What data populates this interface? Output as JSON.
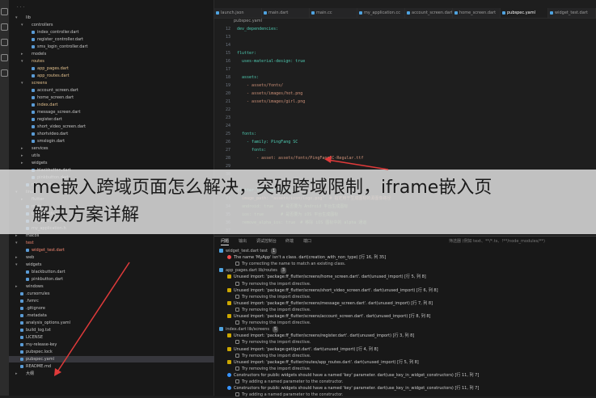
{
  "overlay": {
    "line1": "me嵌入跨域页面怎么解决，突破跨域限制，iframe嵌入页",
    "line2": "解决方案详解"
  },
  "tabs": [
    {
      "label": "launch.json"
    },
    {
      "label": "main.dart"
    },
    {
      "label": "main.cc"
    },
    {
      "label": "my_application.cc"
    },
    {
      "label": "account_screen.dart"
    },
    {
      "label": "home_screen.dart"
    },
    {
      "label": "pubspec.yaml"
    },
    {
      "label": "widget_test.dart"
    }
  ],
  "breadcrumb": "pubspec.yaml",
  "sidebar": {
    "items": [
      {
        "label": "lib",
        "indent": 0,
        "arrow": "▾",
        "color": "#c5c5c5"
      },
      {
        "label": "controllers",
        "indent": 1,
        "arrow": "▾",
        "color": "#c5c5c5"
      },
      {
        "label": "index_controller.dart",
        "indent": 2,
        "arrow": "",
        "color": "#c5c5c5"
      },
      {
        "label": "register_controller.dart",
        "indent": 2,
        "arrow": "",
        "color": "#c5c5c5"
      },
      {
        "label": "sms_login_controller.dart",
        "indent": 2,
        "arrow": "",
        "color": "#c5c5c5"
      },
      {
        "label": "models",
        "indent": 1,
        "arrow": "▸",
        "color": "#c5c5c5"
      },
      {
        "label": "routes",
        "indent": 1,
        "arrow": "▾",
        "color": "#e2c08d"
      },
      {
        "label": "app_pages.dart",
        "indent": 2,
        "arrow": "",
        "color": "#e2c08d"
      },
      {
        "label": "app_routes.dart",
        "indent": 2,
        "arrow": "",
        "color": "#e2c08d"
      },
      {
        "label": "screens",
        "indent": 1,
        "arrow": "▾",
        "color": "#e2c08d"
      },
      {
        "label": "account_screen.dart",
        "indent": 2,
        "arrow": "",
        "color": "#c5c5c5"
      },
      {
        "label": "home_screen.dart",
        "indent": 2,
        "arrow": "",
        "color": "#c5c5c5"
      },
      {
        "label": "index.dart",
        "indent": 2,
        "arrow": "",
        "color": "#e2c08d"
      },
      {
        "label": "message_screen.dart",
        "indent": 2,
        "arrow": "",
        "color": "#c5c5c5"
      },
      {
        "label": "register.dart",
        "indent": 2,
        "arrow": "",
        "color": "#c5c5c5"
      },
      {
        "label": "short_video_screen.dart",
        "indent": 2,
        "arrow": "",
        "color": "#c5c5c5"
      },
      {
        "label": "shortvideo.dart",
        "indent": 2,
        "arrow": "",
        "color": "#c5c5c5"
      },
      {
        "label": "smslogin.dart",
        "indent": 2,
        "arrow": "",
        "color": "#c5c5c5"
      },
      {
        "label": "services",
        "indent": 1,
        "arrow": "▸",
        "color": "#c5c5c5"
      },
      {
        "label": "utils",
        "indent": 1,
        "arrow": "▸",
        "color": "#c5c5c5"
      },
      {
        "label": "widgets",
        "indent": 1,
        "arrow": "▸",
        "color": "#c5c5c5"
      },
      {
        "label": "blackbutton.dart",
        "indent": 2,
        "arrow": "",
        "color": "#c5c5c5"
      },
      {
        "label": "pinkbutton.dart",
        "indent": 2,
        "arrow": "",
        "color": "#c5c5c5"
      },
      {
        "label": "main.dart",
        "indent": 1,
        "arrow": "",
        "color": "#c5c5c5"
      },
      {
        "label": "linux",
        "indent": 0,
        "arrow": "▾",
        "color": "#c5c5c5"
      },
      {
        "label": "flutter",
        "indent": 1,
        "arrow": "▸",
        "color": "#c5c5c5"
      },
      {
        "label": "main.cc",
        "indent": 1,
        "arrow": "",
        "color": "#c5c5c5"
      },
      {
        "label": "CMakeLists.txt",
        "indent": 1,
        "arrow": "",
        "color": "#c5c5c5"
      },
      {
        "label": "my_application.cc",
        "indent": 1,
        "arrow": "",
        "color": "#c5c5c5"
      },
      {
        "label": "my_application.h",
        "indent": 1,
        "arrow": "",
        "color": "#c5c5c5"
      },
      {
        "label": "macos",
        "indent": 0,
        "arrow": "▸",
        "color": "#c5c5c5"
      },
      {
        "label": "test",
        "indent": 0,
        "arrow": "▾",
        "color": "#f48771"
      },
      {
        "label": "widget_test.dart",
        "indent": 1,
        "arrow": "",
        "color": "#f48771"
      },
      {
        "label": "web",
        "indent": 0,
        "arrow": "▸",
        "color": "#c5c5c5"
      },
      {
        "label": "widgets",
        "indent": 0,
        "arrow": "▾",
        "color": "#c5c5c5"
      },
      {
        "label": "blackbutton.dart",
        "indent": 1,
        "arrow": "",
        "color": "#c5c5c5"
      },
      {
        "label": "pinkbutton.dart",
        "indent": 1,
        "arrow": "",
        "color": "#c5c5c5"
      },
      {
        "label": "windows",
        "indent": 0,
        "arrow": "▸",
        "color": "#c5c5c5"
      },
      {
        "label": ".cursorrules",
        "indent": 0,
        "arrow": "",
        "color": "#c5c5c5"
      },
      {
        "label": ".fvmrc",
        "indent": 0,
        "arrow": "",
        "color": "#c5c5c5"
      },
      {
        "label": ".gitignore",
        "indent": 0,
        "arrow": "",
        "color": "#c5c5c5"
      },
      {
        "label": ".metadata",
        "indent": 0,
        "arrow": "",
        "color": "#c5c5c5"
      },
      {
        "label": "analysis_options.yaml",
        "indent": 0,
        "arrow": "",
        "color": "#c5c5c5"
      },
      {
        "label": "build_log.txt",
        "indent": 0,
        "arrow": "",
        "color": "#c5c5c5"
      },
      {
        "label": "LICENSE",
        "indent": 0,
        "arrow": "",
        "color": "#c5c5c5"
      },
      {
        "label": "my-release-key",
        "indent": 0,
        "arrow": "",
        "color": "#c5c5c5"
      },
      {
        "label": "pubspec.lock",
        "indent": 0,
        "arrow": "",
        "color": "#c5c5c5"
      },
      {
        "label": "pubspec.yaml",
        "indent": 0,
        "arrow": "",
        "color": "#c5c5c5",
        "selected": true
      },
      {
        "label": "README.md",
        "indent": 0,
        "arrow": "",
        "color": "#c5c5c5"
      },
      {
        "label": "大纲",
        "indent": 0,
        "arrow": "▸",
        "color": "#c5c5c5"
      }
    ]
  },
  "editor": {
    "lines": [
      {
        "n": "12",
        "text": "dev_dependencies:",
        "cls": "k"
      },
      {
        "n": "13",
        "text": "",
        "cls": "p"
      },
      {
        "n": "14",
        "text": "",
        "cls": "p"
      },
      {
        "n": "15",
        "text": "flutter:",
        "cls": "k"
      },
      {
        "n": "16",
        "text": "  uses-material-design: true",
        "cls": "k"
      },
      {
        "n": "17",
        "text": "",
        "cls": "p"
      },
      {
        "n": "18",
        "text": "  assets:",
        "cls": "k"
      },
      {
        "n": "19",
        "text": "    - assets/fonts/",
        "cls": "s"
      },
      {
        "n": "20",
        "text": "    - assets/images/hot.png",
        "cls": "s"
      },
      {
        "n": "21",
        "text": "    - assets/images/girl.png",
        "cls": "s"
      },
      {
        "n": "22",
        "text": "",
        "cls": "p"
      },
      {
        "n": "23",
        "text": "",
        "cls": "p"
      },
      {
        "n": "24",
        "text": "",
        "cls": "p"
      },
      {
        "n": "25",
        "text": "  fonts:",
        "cls": "k"
      },
      {
        "n": "26",
        "text": "    - family: PingFang SC",
        "cls": "k"
      },
      {
        "n": "27",
        "text": "      fonts:",
        "cls": "k"
      },
      {
        "n": "28",
        "text": "        - asset: assets/fonts/PingFangSC-Regular.ttf",
        "cls": "s"
      },
      {
        "n": "29",
        "text": "",
        "cls": "p"
      },
      {
        "n": "30",
        "text": "",
        "cls": "p"
      },
      {
        "n": "31",
        "text": "",
        "cls": "p"
      },
      {
        "n": "32",
        "text": "flutter_launcher_icons:",
        "cls": "k"
      },
      {
        "n": "33",
        "text": "  image_path: \"assets/icon/logo.png\"  # 指定用于生成图标的源图像路径",
        "cls": "s"
      },
      {
        "n": "34",
        "text": "  android: true   # 是否要为 Android 平台生成图标",
        "cls": "c"
      },
      {
        "n": "35",
        "text": "  ios: true       # 是否要为 iOS 平台生成图标",
        "cls": "c"
      },
      {
        "n": "36",
        "text": "  remove_alpha_ios: true  # 移除 iOS 图标中的 alpha 通道",
        "cls": "c"
      },
      {
        "n": "37",
        "text": "",
        "cls": "p"
      }
    ]
  },
  "panel": {
    "tabs": [
      "问题",
      "输出",
      "调试控制台",
      "终端",
      "端口"
    ],
    "filter_text": "筛选器 (例如 text、**/*.ts、!**/node_modules/**)",
    "rows": [
      {
        "type": "file",
        "text": "widget_test.dart test",
        "count": "1",
        "indent": 0
      },
      {
        "type": "err",
        "text": "The name 'MyApp' isn't a class. dart(creation_with_non_type) [行 16, 列 35]",
        "indent": 1
      },
      {
        "type": "fix",
        "text": "Try correcting the name to match an existing class.",
        "indent": 2
      },
      {
        "type": "file",
        "text": "app_pages.dart lib/routes",
        "count": "3",
        "indent": 0
      },
      {
        "type": "warn",
        "text": "Unused import: 'package:ff_flutter/screens/home_screen.dart'. dart(unused_import) [行 5, 列 8]",
        "indent": 1
      },
      {
        "type": "fix",
        "text": "Try removing the import directive.",
        "indent": 2
      },
      {
        "type": "warn",
        "text": "Unused import: 'package:ff_flutter/screens/short_video_screen.dart'. dart(unused_import) [行 6, 列 8]",
        "indent": 1
      },
      {
        "type": "fix",
        "text": "Try removing the import directive.",
        "indent": 2
      },
      {
        "type": "warn",
        "text": "Unused import: 'package:ff_flutter/screens/message_screen.dart'. dart(unused_import) [行 7, 列 8]",
        "indent": 1
      },
      {
        "type": "fix",
        "text": "Try removing the import directive.",
        "indent": 2
      },
      {
        "type": "warn",
        "text": "Unused import: 'package:ff_flutter/screens/account_screen.dart'. dart(unused_import) [行 8, 列 8]",
        "indent": 1
      },
      {
        "type": "fix",
        "text": "Try removing the import directive.",
        "indent": 2
      },
      {
        "type": "file",
        "text": "index.dart lib/screens",
        "count": "5",
        "indent": 0
      },
      {
        "type": "warn",
        "text": "Unused import: 'package:ff_flutter/screens/register.dart'. dart(unused_import) [行 3, 列 8]",
        "indent": 1
      },
      {
        "type": "fix",
        "text": "Try removing the import directive.",
        "indent": 2
      },
      {
        "type": "warn",
        "text": "Unused import: 'package:get/get.dart'. dart(unused_import) [行 4, 列 8]",
        "indent": 1
      },
      {
        "type": "fix",
        "text": "Try removing the import directive.",
        "indent": 2
      },
      {
        "type": "warn",
        "text": "Unused import: 'package:ff_flutter/routes/app_routes.dart'. dart(unused_import) [行 5, 列 8]",
        "indent": 1
      },
      {
        "type": "fix",
        "text": "Try removing the import directive.",
        "indent": 2
      },
      {
        "type": "info",
        "text": "Constructors for public widgets should have a named 'key' parameter. dart(use_key_in_widget_constructors) [行 11, 列 7]",
        "indent": 1
      },
      {
        "type": "fix",
        "text": "Try adding a named parameter to the constructor.",
        "indent": 2
      },
      {
        "type": "info",
        "text": "Constructors for public widgets should have a named 'key' parameter. dart(use_key_in_widget_constructors) [行 11, 列 7]",
        "indent": 1
      },
      {
        "type": "fix",
        "text": "Try adding a named parameter to the constructor.",
        "indent": 2
      }
    ]
  },
  "colors": {
    "accent": "#007acc",
    "arrow": "#e03a3a"
  }
}
